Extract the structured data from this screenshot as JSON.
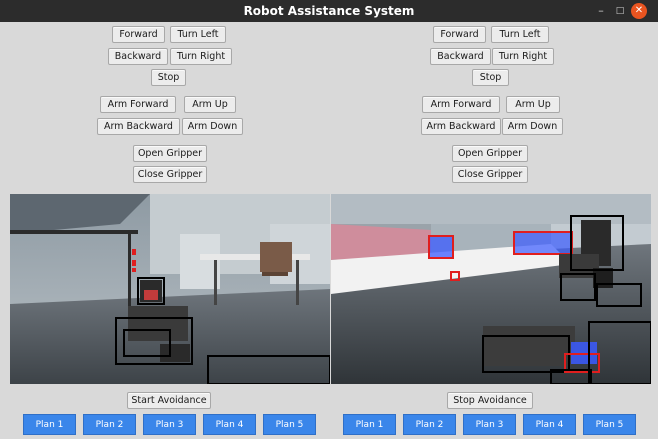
{
  "window": {
    "title": "Robot Assistance System",
    "minimize_glyph": "–",
    "maximize_glyph": "□",
    "close_glyph": "✕"
  },
  "left": {
    "forward": "Forward",
    "turn_left": "Turn Left",
    "backward": "Backward",
    "turn_right": "Turn Right",
    "stop": "Stop",
    "arm_forward": "Arm Forward",
    "arm_up": "Arm Up",
    "arm_backward": "Arm Backward",
    "arm_down": "Arm Down",
    "open_gripper": "Open Gripper",
    "close_gripper": "Close Gripper",
    "avoidance": "Start Avoidance",
    "plans": [
      "Plan 1",
      "Plan 2",
      "Plan 3",
      "Plan 4",
      "Plan 5"
    ]
  },
  "right": {
    "forward": "Forward",
    "turn_left": "Turn Left",
    "backward": "Backward",
    "turn_right": "Turn Right",
    "stop": "Stop",
    "arm_forward": "Arm Forward",
    "arm_up": "Arm Up",
    "arm_backward": "Arm Backward",
    "arm_down": "Arm Down",
    "open_gripper": "Open Gripper",
    "close_gripper": "Close Gripper",
    "avoidance": "Stop Avoidance",
    "plans": [
      "Plan 1",
      "Plan 2",
      "Plan 3",
      "Plan 4",
      "Plan 5"
    ]
  },
  "colors": {
    "titlebar": "#2c2c2c",
    "window_bg": "#d9d9d9",
    "plan_button": "#3a86ea",
    "close_button": "#e95420",
    "detection_box": "#000000",
    "highlight_box": "#e01e1e",
    "highlight_fill": "#3b5bff"
  }
}
